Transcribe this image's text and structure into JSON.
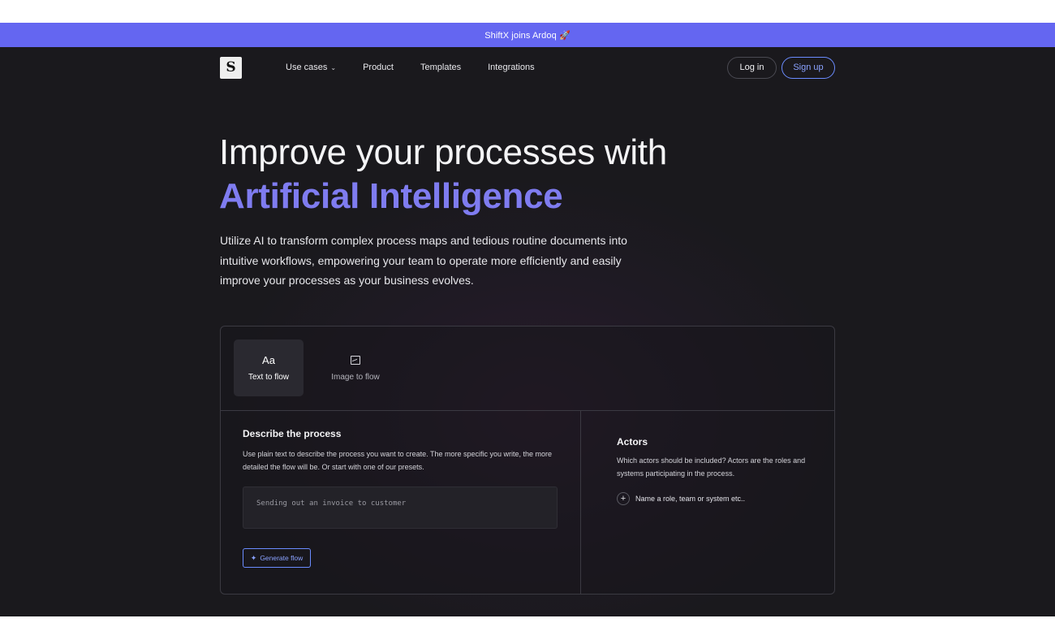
{
  "banner": {
    "text": "ShiftX joins Ardoq 🚀"
  },
  "nav": {
    "logo_letter": "S",
    "links": [
      {
        "label": "Use cases",
        "has_dropdown": true
      },
      {
        "label": "Product"
      },
      {
        "label": "Templates"
      },
      {
        "label": "Integrations"
      }
    ],
    "login_label": "Log in",
    "signup_label": "Sign up"
  },
  "hero": {
    "title_line1": "Improve your processes with",
    "title_line2": "Artificial Intelligence",
    "description": "Utilize AI to transform complex process maps and tedious routine documents into intuitive workflows, empowering your team to operate more efficiently and easily improve your processes as your business evolves."
  },
  "tabs": [
    {
      "icon_text": "Aa",
      "label": "Text to flow",
      "active": true
    },
    {
      "icon": "image-icon",
      "label": "Image to flow",
      "active": false
    }
  ],
  "describe": {
    "title": "Describe the process",
    "description": "Use plain text to describe the process you want to create. The more specific you write, the more detailed the flow will be. Or start with one of our presets.",
    "input_placeholder": "Sending out an invoice to customer",
    "generate_label": "Generate flow"
  },
  "actors": {
    "title": "Actors",
    "description": "Which actors should be included? Actors are the roles and systems participating in the process.",
    "add_label": "Name a role, team or system etc.."
  },
  "colors": {
    "banner": "#6466f1",
    "accent": "#7f7cf0",
    "link_blue": "#8aa2ff",
    "background": "#1a191d"
  }
}
